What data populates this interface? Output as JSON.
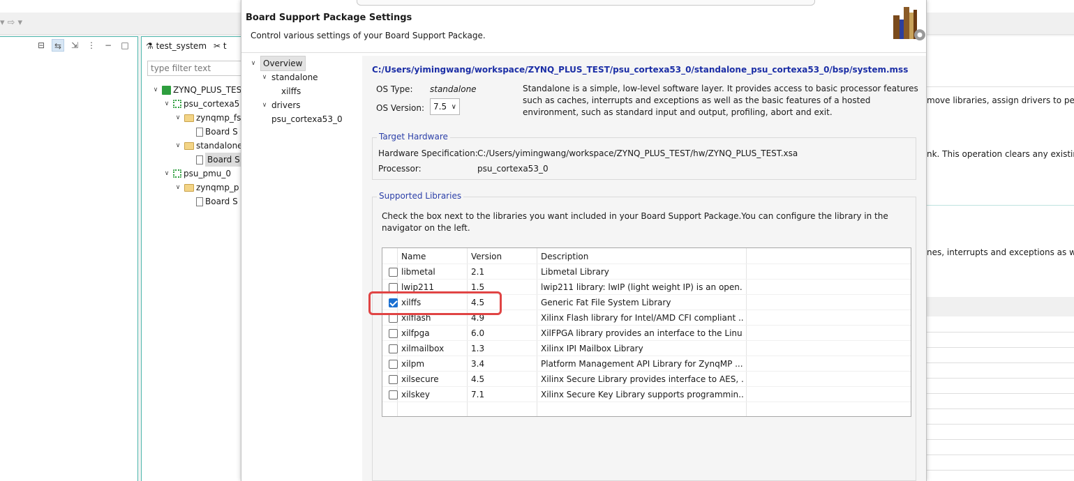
{
  "ide": {
    "nav_back_icon": "arrow-left-icon",
    "nav_forward_icon": "arrow-right-icon",
    "explorer_tabs": [
      "test_system",
      "t"
    ],
    "filter_placeholder": "type filter text",
    "tree": [
      {
        "label": "ZYNQ_PLUS_TES",
        "icon": "system-project-icon"
      },
      {
        "label": "psu_cortexa5",
        "icon": "processor-icon"
      },
      {
        "label": "zynqmp_fs",
        "icon": "folder-icon"
      },
      {
        "label": "Board S",
        "icon": "document-icon"
      },
      {
        "label": "standalone",
        "icon": "folder-icon"
      },
      {
        "label": "Board S",
        "icon": "document-icon"
      },
      {
        "label": "psu_pmu_0",
        "icon": "processor-icon"
      },
      {
        "label": "zynqmp_p",
        "icon": "folder-icon"
      },
      {
        "label": "Board S",
        "icon": "document-icon"
      }
    ],
    "right_fragments": [
      "move libraries, assign drivers to peri",
      "nk. This operation clears any existing",
      "nes, interrupts and exceptions as wel"
    ]
  },
  "dialog": {
    "title": "Board Support Package Settings",
    "subtitle": "Control various settings of your Board Support Package.",
    "nav": [
      {
        "label": "Overview",
        "level": 0,
        "expanded": true
      },
      {
        "label": "standalone",
        "level": 1,
        "expanded": true
      },
      {
        "label": "xilffs",
        "level": 2
      },
      {
        "label": "drivers",
        "level": 1,
        "expanded": true
      },
      {
        "label": "psu_cortexa53_0",
        "level": 2
      }
    ],
    "mss_path": "C:/Users/yimingwang/workspace/ZYNQ_PLUS_TEST/psu_cortexa53_0/standalone_psu_cortexa53_0/bsp/system.mss",
    "os_type_label": "OS Type:",
    "os_type_value": "standalone",
    "os_version_label": "OS Version:",
    "os_version_value": "7.5",
    "os_description": "Standalone is a simple, low-level software layer. It provides access to basic processor features such as caches, interrupts and exceptions as well as the basic features of a hosted environment, such as standard input and output, profiling, abort and exit.",
    "target_hardware": {
      "title": "Target Hardware",
      "hw_spec_label": "Hardware Specification:",
      "hw_spec_value": "C:/Users/yimingwang/workspace/ZYNQ_PLUS_TEST/hw/ZYNQ_PLUS_TEST.xsa",
      "processor_label": "Processor:",
      "processor_value": "psu_cortexa53_0"
    },
    "supported_libraries": {
      "title": "Supported Libraries",
      "instructions": "Check the box next to the libraries you want included in your Board Support Package.You can configure the library in the navigator on the left.",
      "columns": [
        "Name",
        "Version",
        "Description"
      ],
      "rows": [
        {
          "name": "libmetal",
          "version": "2.1",
          "description": "Libmetal Library",
          "checked": false
        },
        {
          "name": "lwip211",
          "version": "1.5",
          "description": "lwip211 library: lwIP (light weight IP) is an open...",
          "checked": false
        },
        {
          "name": "xilffs",
          "version": "4.5",
          "description": "Generic Fat File System Library",
          "checked": true
        },
        {
          "name": "xilflash",
          "version": "4.9",
          "description": "Xilinx Flash library for Intel/AMD CFI compliant ...",
          "checked": false
        },
        {
          "name": "xilfpga",
          "version": "6.0",
          "description": "XilFPGA library provides an interface to the Linu...",
          "checked": false
        },
        {
          "name": "xilmailbox",
          "version": "1.3",
          "description": "Xilinx IPI Mailbox Library",
          "checked": false
        },
        {
          "name": "xilpm",
          "version": "3.4",
          "description": "Platform Management API Library for ZynqMP ...",
          "checked": false
        },
        {
          "name": "xilsecure",
          "version": "4.5",
          "description": "Xilinx Secure Library provides interface to AES, ...",
          "checked": false
        },
        {
          "name": "xilskey",
          "version": "7.1",
          "description": "Xilinx Secure Key Library supports programmin...",
          "checked": false
        }
      ]
    },
    "highlight_color": "#e04444",
    "accent_color": "#1c2fa6"
  }
}
